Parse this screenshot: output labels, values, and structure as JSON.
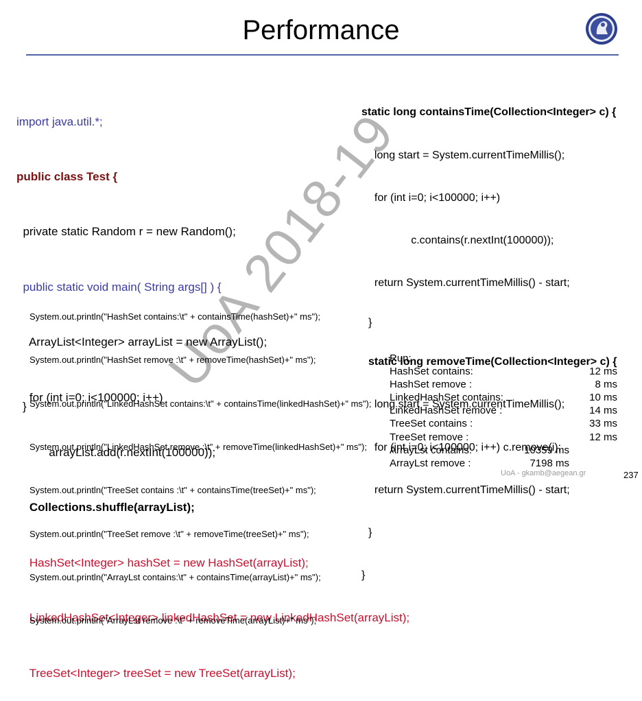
{
  "slide": {
    "title": "Performance",
    "page_number": "237",
    "footer": "UoA - gkamb@aegean.gr",
    "watermark": "UoA 2018-19"
  },
  "left_code": [
    "import java.util.*;",
    "public class Test {",
    "  private static Random r = new Random();",
    "  public static void main( String args[] ) {",
    "    ArrayList<Integer> arrayList = new ArrayList();",
    "    for (int i=0; i<100000; i++)",
    "          arrayList.add(r.nextInt(100000));",
    "    Collections.shuffle(arrayList);",
    "    HashSet<Integer> hashSet = new HashSet(arrayList);",
    "    LinkedHashSet<Integer> linkedHashSet = new LinkedHashSet(arrayList);",
    "    TreeSet<Integer> treeSet = new TreeSet(arrayList);"
  ],
  "println_code": [
    "System.out.println(\"HashSet contains:\\t\" + containsTime(hashSet)+\" ms\");",
    "System.out.println(\"HashSet remove :\\t\" + removeTime(hashSet)+\" ms\");",
    "System.out.println(\"LinkedHashSet contains:\\t\" + containsTime(linkedHashSet)+\" ms\");",
    "System.out.println(\"LinkedHashSet remove :\\t\" + removeTime(linkedHashSet)+\" ms\");",
    "System.out.println(\"TreeSet contains :\\t\" + containsTime(treeSet)+\" ms\");",
    "System.out.println(\"TreeSet remove :\\t\" + removeTime(treeSet)+\" ms\");",
    "System.out.println(\"ArrayLst contains:\\t\" + containsTime(arrayList)+\" ms\");",
    "System.out.println(\"ArrayLst remove :\\t\" + removeTime(arrayList)+\" ms\");"
  ],
  "closing_brace": "}",
  "right_code": [
    "static long containsTime(Collection<Integer> c) {",
    "  long start = System.currentTimeMillis();",
    "  for (int i=0; i<100000; i++)",
    "              c.contains(r.nextInt(100000));",
    "  return System.currentTimeMillis() - start;",
    "}",
    "static long removeTime(Collection<Integer> c) {",
    "  long start = System.currentTimeMillis();",
    "  for (int i=0; i<100000; i++) c.remove(i);",
    "  return System.currentTimeMillis() - start;",
    "}",
    "}"
  ],
  "results": {
    "header": "Run:",
    "rows": [
      {
        "label": "HashSet contains:",
        "value": "12 ms"
      },
      {
        "label": "HashSet remove :",
        "value": "8 ms"
      },
      {
        "label": "LinkedHashSet contains:",
        "value": "10 ms"
      },
      {
        "label": "LinkedHashSet remove :",
        "value": "14 ms"
      },
      {
        "label": "TreeSet contains :",
        "value": "33 ms"
      },
      {
        "label": "TreeSet remove :",
        "value": "12 ms"
      },
      {
        "label": "ArrayLst contains:",
        "value": "10359 ms"
      },
      {
        "label": "ArrayLst remove :",
        "value": "7198 ms"
      }
    ]
  }
}
